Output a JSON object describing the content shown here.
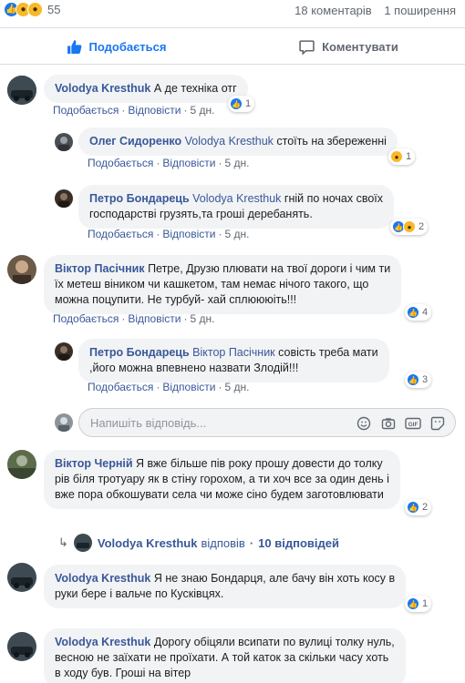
{
  "post_stats": {
    "reaction_count": "55",
    "comments": "18 коментарів",
    "shares": "1 поширення"
  },
  "actions": {
    "like": "Подобається",
    "comment": "Коментувати"
  },
  "labels": {
    "like": "Подобається",
    "reply": "Відповісти"
  },
  "comments": [
    {
      "author": "Volodya Kresthuk",
      "text": "А де техніка отг",
      "time": "5 дн.",
      "reactions": "1"
    },
    {
      "author": "Олег Сидоренко",
      "mention": "Volodya Kresthuk",
      "text": "стоїть на збереженні",
      "time": "5 дн.",
      "reactions": "1"
    },
    {
      "author": "Петро Бондарець",
      "mention": "Volodya Kresthuk",
      "text_line1": "гній по ночах своїх",
      "text_line2": "господарстві грузять,та гроші деребанять.",
      "time": "5 дн.",
      "reactions": "2"
    },
    {
      "author": "Віктор Пасічник",
      "text_line1": "Петре, Друзю плювати на твої дороги і чим ти",
      "text_line2": "їх метеш віником чи кашкетом, там немає нічого такого, що",
      "text_line3": "можна поцупити. Не турбуй- хай сплюююіть!!!",
      "time": "5 дн.",
      "reactions": "4"
    },
    {
      "author": "Петро Бондарець",
      "mention": "Віктор Пасічник",
      "text_line1": "совість треба мати",
      "text_line2": ",його можна впевнено назвати Злодій!!!",
      "time": "5 дн.",
      "reactions": "3"
    },
    {
      "author": "Віктор Черній",
      "text_line1": "Я вже більше пів року прошу довести до толку",
      "text_line2": "рів біля тротуару як в стіну горохом, а ти хоч все за один день і",
      "text_line3": "вже пора обкошувати села чи може сіно будем заготовлювати",
      "reactions": "2"
    },
    {
      "author": "Volodya Kresthuk",
      "text_line1": "Я не знаю Бондарця, але бачу він хоть косу в",
      "text_line2": "руки бере і вальче по Кусківцях.",
      "reactions": "1"
    },
    {
      "author": "Volodya Kresthuk",
      "text_line1": "Дорогу обіцяли всипати по вулиці толку нуль,",
      "text_line2": "весною не заїхати не проїхати. А той каток за скільки часу хоть",
      "text_line3": "в ходу був. Гроші на вітер"
    }
  ],
  "reply_input": {
    "placeholder": "Напишіть відповідь..."
  },
  "replies_link": {
    "author": "Volodya Kresthuk",
    "action": "відповів",
    "count": "10 відповідей"
  },
  "icons": [
    "like-icon",
    "wow-icon",
    "sad-icon",
    "haha-icon",
    "comment-icon",
    "emoji-icon",
    "camera-icon",
    "gif-icon",
    "sticker-icon",
    "reply-arrow-icon"
  ],
  "colors": {
    "link": "#385898",
    "meta": "#606770",
    "bubble": "#f2f3f5",
    "like": "#1877f2",
    "emoji": "#f7b928"
  }
}
